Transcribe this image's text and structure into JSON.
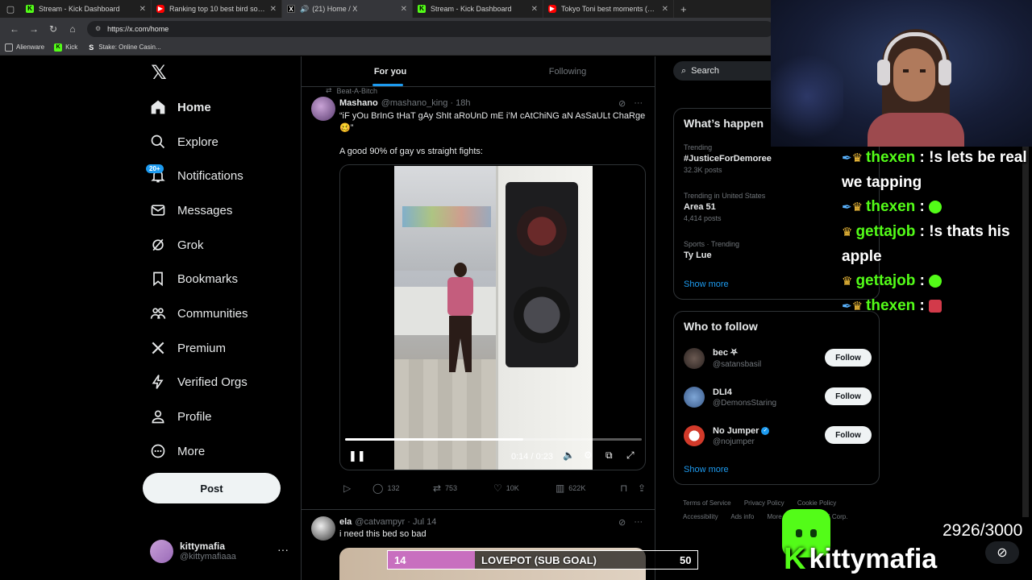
{
  "browser": {
    "tabs": [
      {
        "label": "Stream - Kick Dashboard",
        "favicon": "kick"
      },
      {
        "label": "Ranking top 10 best bird sounds",
        "favicon": "youtube"
      },
      {
        "label": "(21) Home / X",
        "favicon": "x",
        "active": true,
        "audio": true
      },
      {
        "label": "Stream - Kick Dashboard",
        "favicon": "kick"
      },
      {
        "label": "Tokyo Toni best moments (Comp",
        "favicon": "youtube"
      }
    ],
    "url": "https://x.com/home",
    "bookmarks": [
      "Alienware",
      "Kick",
      "Stake: Online Casin..."
    ]
  },
  "sidebar": {
    "items": [
      {
        "label": "Home",
        "icon": "home-icon"
      },
      {
        "label": "Explore",
        "icon": "search-icon"
      },
      {
        "label": "Notifications",
        "icon": "bell-icon"
      },
      {
        "label": "Messages",
        "icon": "envelope-icon"
      },
      {
        "label": "Grok",
        "icon": "grok-icon"
      },
      {
        "label": "Bookmarks",
        "icon": "bookmark-icon"
      },
      {
        "label": "Communities",
        "icon": "people-icon"
      },
      {
        "label": "Premium",
        "icon": "x-icon"
      },
      {
        "label": "Verified Orgs",
        "icon": "lightning-icon"
      },
      {
        "label": "Profile",
        "icon": "person-icon"
      },
      {
        "label": "More",
        "icon": "more-circle-icon"
      }
    ],
    "notifications_badge": "20+",
    "post_label": "Post",
    "account": {
      "name": "kittymafia",
      "handle": "@kittymafiaaa"
    }
  },
  "timeline": {
    "tabs": [
      "For you",
      "Following"
    ],
    "tweet1": {
      "repost_by": "Beat-A-Bitch",
      "name": "Mashano",
      "handle": "@mashano_king · 18h",
      "text": "“iF yOu BrInG tHaT gAy ShIt aRoUnD mE i’M cAtChiNG aN AsSaULt ChaRge 🥴”",
      "text2": "A good 90% of gay vs straight fights:",
      "video_time": "0:14 / 0:23",
      "video_progress": 0.6,
      "replies": "132",
      "reposts": "753",
      "likes": "10K",
      "views": "622K"
    },
    "tweet2": {
      "name": "ela",
      "handle": "@catvampyr · Jul 14",
      "text": "i need this bed so bad"
    }
  },
  "right": {
    "search_placeholder": "Search",
    "trends_title": "What’s happen",
    "trends": [
      {
        "meta": "Trending",
        "name": "#JusticeForDemoree",
        "count": "32.3K posts"
      },
      {
        "meta": "Trending in United States",
        "name": "Area 51",
        "count": "4,414 posts"
      },
      {
        "meta": "Sports · Trending",
        "name": "Ty Lue",
        "count": ""
      }
    ],
    "show_more": "Show more",
    "wtf_title": "Who to follow",
    "follow_label": "Follow",
    "who_to_follow": [
      {
        "name": "bec ⛧",
        "handle": "@satansbasil"
      },
      {
        "name": "DLI4",
        "handle": "@DemonsStaring"
      },
      {
        "name": "No Jumper",
        "handle": "@nojumper",
        "verified": true
      }
    ],
    "footer": [
      "Terms of Service",
      "Privacy Policy",
      "Cookie Policy",
      "Accessibility",
      "Ads info",
      "More ···",
      "© 2025 X Corp."
    ]
  },
  "overlay": {
    "chat": [
      {
        "user": "thexen",
        "message": "!s lets be real we tapping",
        "badges": "sword-crown"
      },
      {
        "user": "thexen",
        "message": "",
        "badges": "sword-crown",
        "emote": "green"
      },
      {
        "user": "gettajob",
        "message": "!s thats his apple",
        "badges": "crown"
      },
      {
        "user": "gettajob",
        "message": "",
        "badges": "crown",
        "emote": "green"
      },
      {
        "user": "thexen",
        "message": "",
        "badges": "sword-crown",
        "emote": "red"
      }
    ],
    "subgoal": {
      "current": "14",
      "label": "LOVEPOT (SUB GOAL)",
      "target": "50",
      "progress": 0.28
    },
    "counter": "2926/3000",
    "brand": "kittymafia"
  }
}
